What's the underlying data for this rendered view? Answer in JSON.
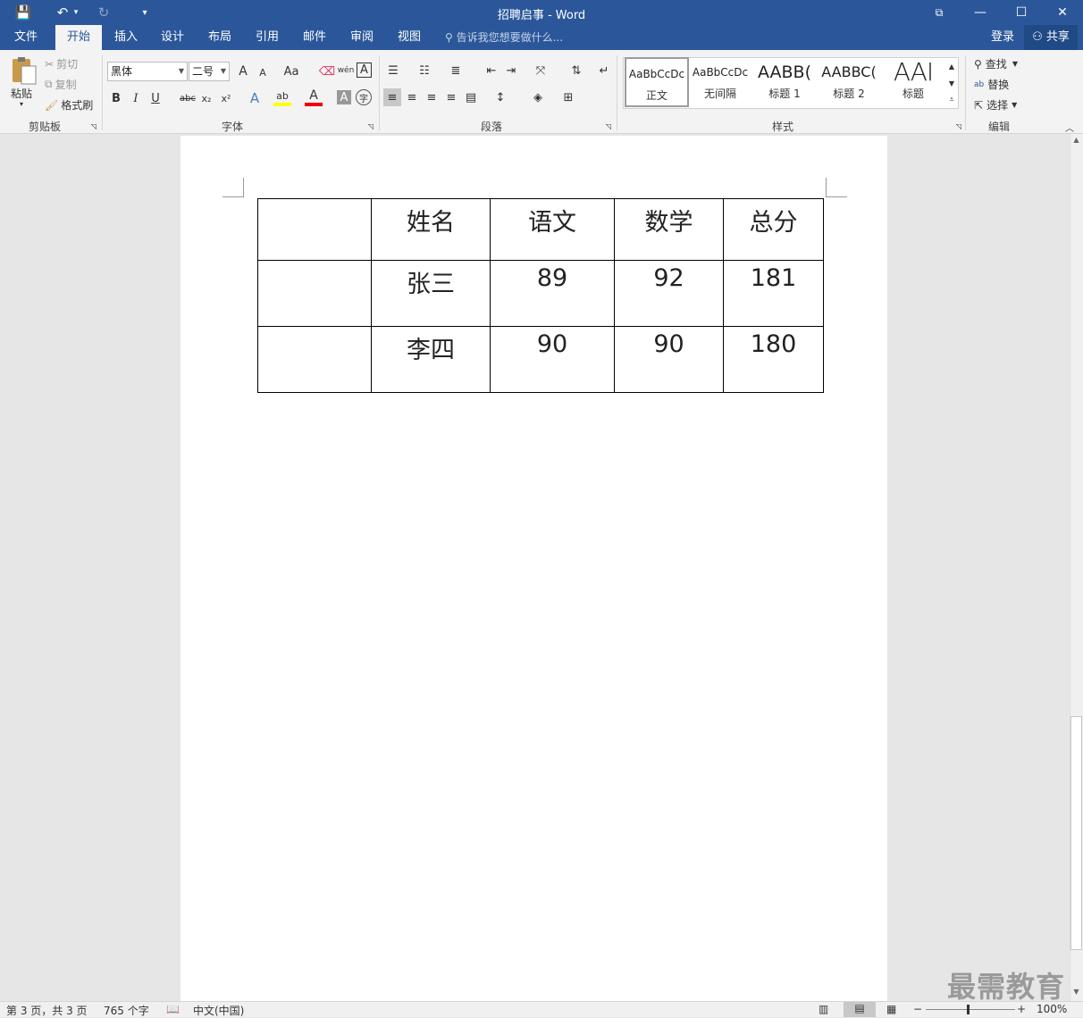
{
  "window": {
    "title": "招聘启事 - Word",
    "controls": {
      "ribbon_display": "⧉",
      "minimize": "—",
      "maximize": "☐",
      "close": "✕"
    }
  },
  "quick_access": {
    "save": "💾",
    "undo": "↶",
    "undo_dd": "▾",
    "redo": "↻",
    "customize": "▾"
  },
  "tabs": [
    "文件",
    "开始",
    "插入",
    "设计",
    "布局",
    "引用",
    "邮件",
    "审阅",
    "视图"
  ],
  "active_tab": "开始",
  "tell_me": "告诉我您想要做什么...",
  "account": {
    "login": "登录",
    "share": "共享"
  },
  "clipboard": {
    "paste": "粘贴",
    "cut": "剪切",
    "copy": "复制",
    "format_painter": "格式刷",
    "group": "剪贴板"
  },
  "font": {
    "name": "黑体",
    "size": "二号",
    "group": "字体",
    "grow": "A",
    "shrink": "A",
    "case": "Aa",
    "bold": "B",
    "italic": "I",
    "underline": "U",
    "strike": "abc",
    "subscript": "x₂",
    "superscript": "x²",
    "effects": "A",
    "highlight": "ab",
    "color": "A",
    "shade": "A",
    "enclose": "字",
    "pinyin": "wén",
    "border": "A"
  },
  "paragraph": {
    "group": "段落"
  },
  "styles": {
    "group": "样式",
    "items": [
      {
        "preview": "AaBbCcDc",
        "name": "正文"
      },
      {
        "preview": "AaBbCcDc",
        "name": "无间隔"
      },
      {
        "preview": "AABB(",
        "name": "标题 1"
      },
      {
        "preview": "AABBC(",
        "name": "标题 2"
      },
      {
        "preview": "AAI",
        "name": "标题"
      }
    ]
  },
  "editing": {
    "find": "查找",
    "replace": "替换",
    "select": "选择",
    "group": "编辑"
  },
  "table": {
    "header": [
      "",
      "姓名",
      "语文",
      "数学",
      "总分"
    ],
    "rows": [
      [
        "",
        "张三",
        "89",
        "92",
        "181"
      ],
      [
        "",
        "李四",
        "90",
        "90",
        "180"
      ]
    ]
  },
  "status": {
    "page": "第 3 页，共 3 页",
    "words": "765 个字",
    "language": "中文(中国)",
    "zoom": "100%"
  },
  "watermark": "最需教育"
}
